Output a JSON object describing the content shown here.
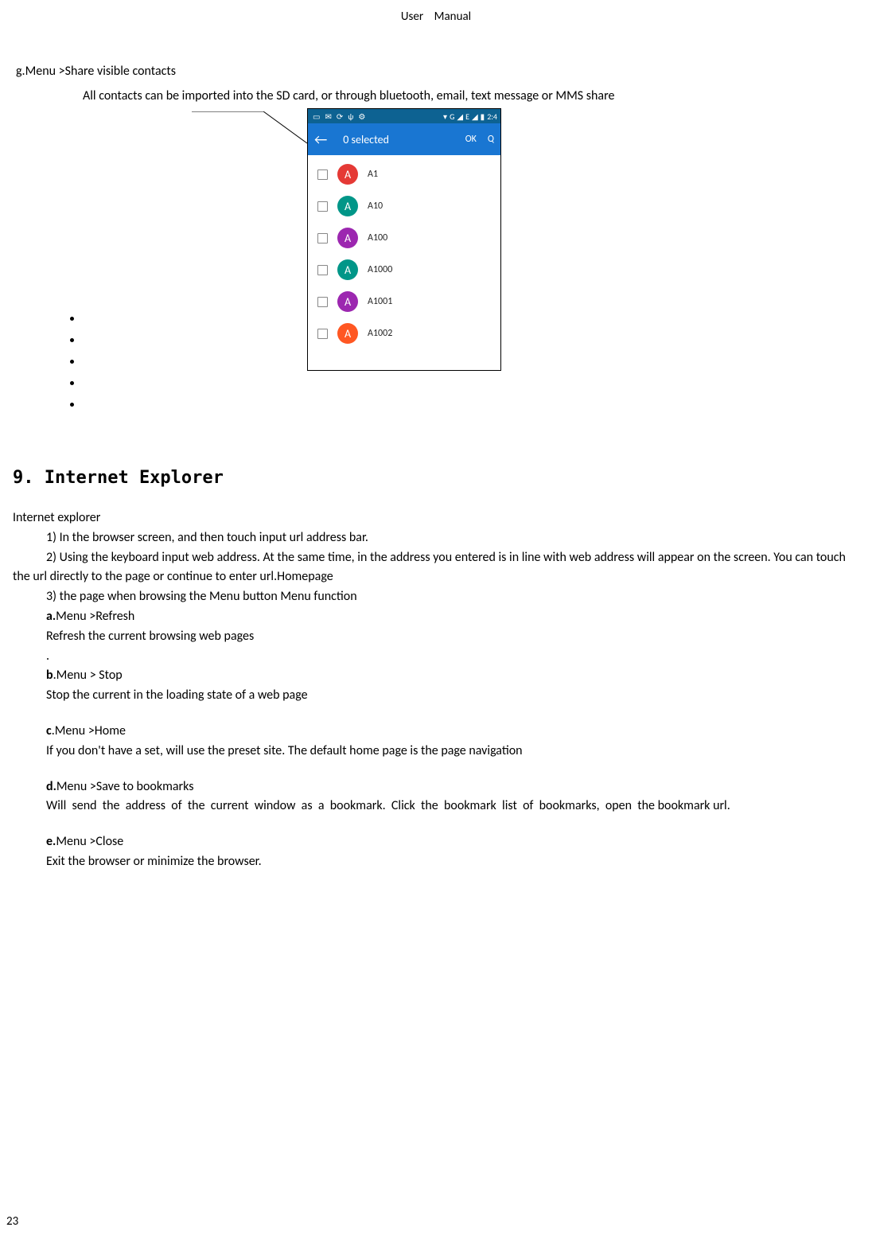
{
  "header": {
    "left": "User",
    "right": "Manual"
  },
  "sectionG": {
    "title": "g.Menu >Share visible contacts",
    "desc": "All contacts can be imported into the SD card, or through bluetooth, email, text message or MMS share"
  },
  "screenshot": {
    "statusTime": "2:4",
    "statusNet": "G",
    "statusE": "E",
    "appBarTitle": "0 selected",
    "okLabel": "OK",
    "contacts": [
      {
        "name": "A1",
        "color": "red",
        "letter": "A"
      },
      {
        "name": "A10",
        "color": "teal",
        "letter": "A"
      },
      {
        "name": "A100",
        "color": "purple",
        "letter": "A"
      },
      {
        "name": "A1000",
        "color": "teal",
        "letter": "A"
      },
      {
        "name": "A1001",
        "color": "purple",
        "letter": "A"
      },
      {
        "name": "A1002",
        "color": "orange",
        "letter": "A"
      }
    ]
  },
  "section9": {
    "title": "9. Internet Explorer",
    "subtitle": "Internet explorer",
    "p1": "1) In the browser screen, and then touch input url address bar.",
    "p2": "2) Using the keyboard input web address. At the same time, in the address you entered is in line with web address will appear on the screen. You can touch the url directly to the page or continue to enter url.Homepage",
    "p3": "3) the page when browsing the Menu button Menu function",
    "aLabel": "a.",
    "aTitle": "Menu >Refresh",
    "aDesc": "Refresh the current browsing web pages",
    "dot": ".",
    "bLabel": "b",
    "bTitle": ".Menu > Stop",
    "bDesc": "Stop the current in the loading state of a web page",
    "cLabel": "c",
    "cTitle": ".Menu >Home",
    "cDesc": "If you don't have a set, will use the preset site. The default home page is the page navigation",
    "dLabel": "d.",
    "dTitle": "Menu >Save to bookmarks",
    "dDesc": "Will send the address of the current window as a bookmark. Click the bookmark list of bookmarks, open the bookmark url.",
    "eLabel": "e.",
    "eTitle": "Menu >Close",
    "eDesc": "Exit the browser or minimize the browser."
  },
  "pageNumber": "23"
}
